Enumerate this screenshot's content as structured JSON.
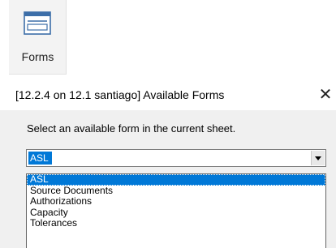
{
  "ribbon": {
    "forms_button": {
      "label": "Forms",
      "icon": "form-window-icon"
    }
  },
  "dialog": {
    "title": "[12.2.4 on 12.1 santiago] Available Forms",
    "close_glyph": "✕",
    "instruction": "Select an available form in the current sheet.",
    "combo": {
      "selected": "ASL"
    },
    "dropdown": {
      "options": [
        "ASL",
        "Source Documents",
        "Authorizations",
        "Capacity",
        "Tolerances"
      ],
      "highlighted_index": 0
    }
  },
  "colors": {
    "selection": "#0078d7",
    "dialog_body": "#f0f0f0",
    "ribbon_button": "#f3f3f3"
  }
}
